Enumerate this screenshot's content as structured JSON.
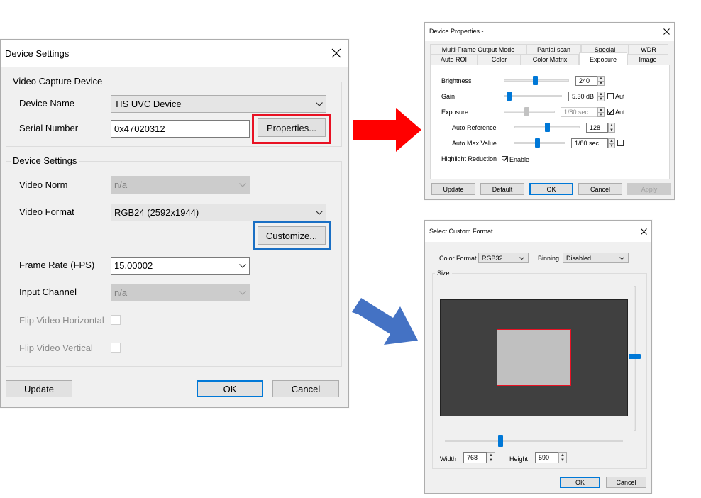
{
  "colors": {
    "accent": "#0078d7",
    "highlight_red": "#e81123",
    "highlight_blue": "#1a6fc4",
    "arrow_red": "#ff0000",
    "arrow_blue": "#4472c4"
  },
  "device_settings": {
    "title": "Device Settings",
    "close_icon": "close-icon",
    "video_capture_group": "Video Capture Device",
    "device_name_label": "Device Name",
    "device_name_value": "TIS UVC Device",
    "serial_label": "Serial Number",
    "serial_value": "0x47020312",
    "properties_button": "Properties...",
    "settings_group": "Device Settings",
    "video_norm_label": "Video Norm",
    "video_norm_value": "n/a",
    "video_format_label": "Video Format",
    "video_format_value": "RGB24 (2592x1944)",
    "customize_button": "Customize...",
    "frame_rate_label": "Frame Rate (FPS)",
    "frame_rate_value": "15.00002",
    "input_channel_label": "Input Channel",
    "input_channel_value": "n/a",
    "flip_h_label": "Flip Video Horizontal",
    "flip_v_label": "Flip Video Vertical",
    "update_button": "Update",
    "ok_button": "OK",
    "cancel_button": "Cancel"
  },
  "device_properties": {
    "title": "Device Properties -",
    "tabs_row1": [
      "Multi-Frame Output Mode",
      "Partial scan",
      "Special",
      "WDR"
    ],
    "tabs_row2": [
      "Auto ROI",
      "Color",
      "Color Matrix",
      "Exposure",
      "Image"
    ],
    "active_tab": "Exposure",
    "brightness_label": "Brightness",
    "brightness_value": "240",
    "brightness_level": 0.48,
    "gain_label": "Gain",
    "gain_value": "5.30 dB",
    "gain_level": 0.08,
    "gain_auto": "Auto",
    "exposure_label": "Exposure",
    "exposure_value": "1/80 sec",
    "exposure_level": 0.45,
    "exposure_auto": "Auto",
    "auto_reference_label": "Auto Reference",
    "auto_reference_value": "128",
    "auto_reference_level": 0.5,
    "auto_max_label": "Auto Max Value",
    "auto_max_value": "1/80 sec",
    "auto_max_level": 0.45,
    "highlight_label": "Highlight Reduction",
    "enable_label": "Enable",
    "update_button": "Update",
    "default_button": "Default",
    "ok_button": "OK",
    "cancel_button": "Cancel",
    "apply_button": "Apply"
  },
  "custom_format": {
    "title": "Select Custom Format",
    "color_format_label": "Color Format",
    "color_format_value": "RGB32",
    "binning_label": "Binning",
    "binning_value": "Disabled",
    "size_group": "Size",
    "width_label": "Width",
    "width_value": "768",
    "height_label": "Height",
    "height_value": "590",
    "ok_button": "OK",
    "cancel_button": "Cancel"
  }
}
